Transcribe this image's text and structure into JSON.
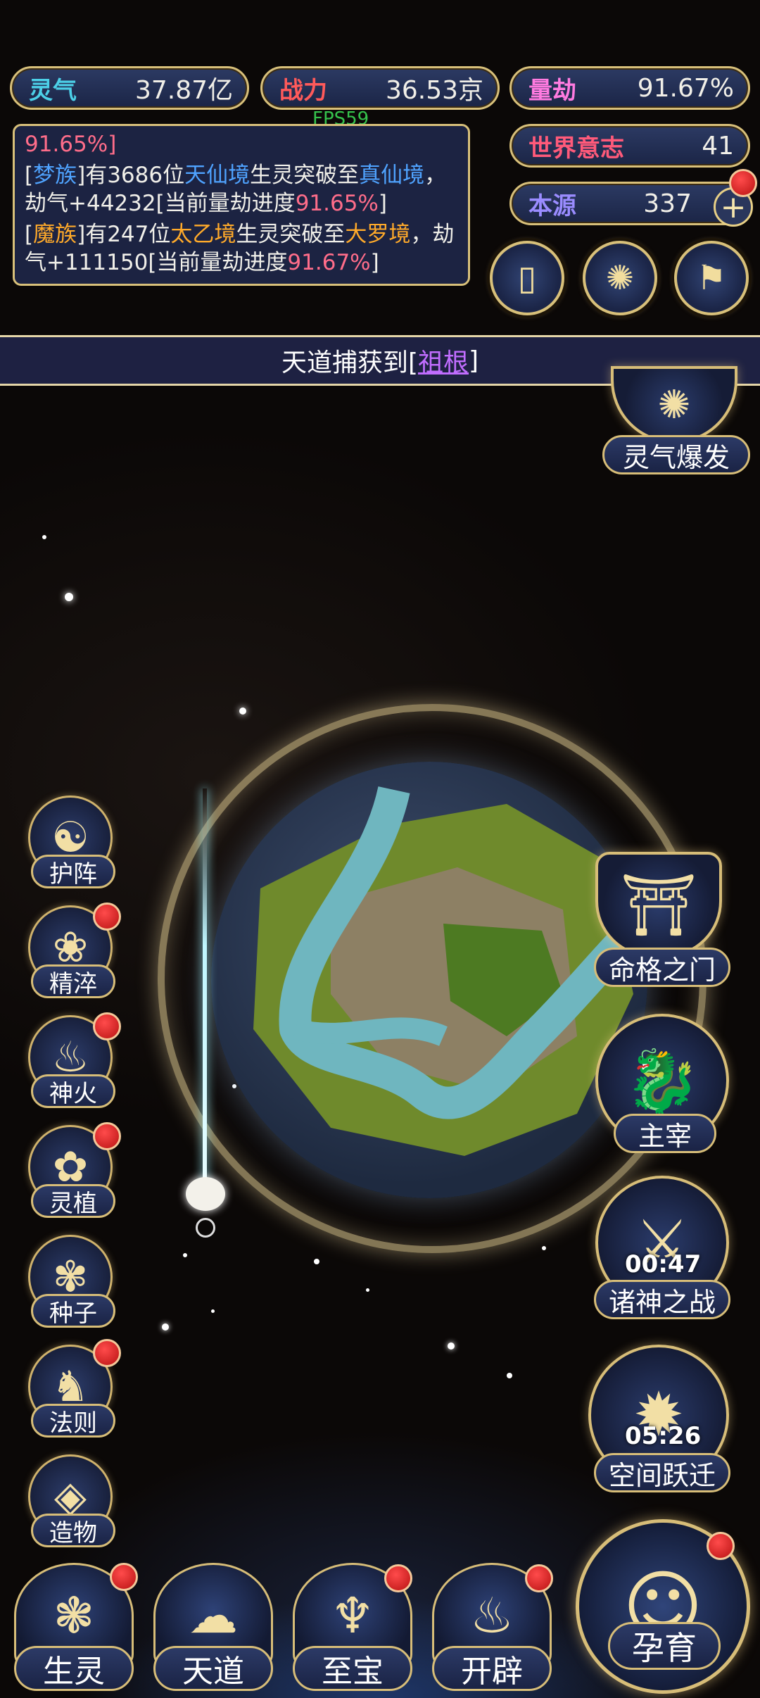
{
  "stats": {
    "lingqi": {
      "label": "灵气",
      "value": "37.87亿",
      "color": "#4cd0e8"
    },
    "zhanli": {
      "label": "战力",
      "value": "36.53京",
      "color": "#ff5a5a"
    },
    "liangjie": {
      "label": "量劫",
      "value": "91.67%",
      "color": "#ff7be0"
    },
    "shijie": {
      "label": "世界意志",
      "value": "41",
      "color": "#ff5a7a"
    },
    "benyuan": {
      "label": "本源",
      "value": "337",
      "color": "#9a8cff"
    }
  },
  "fps": "FPS59",
  "log": {
    "line0": "91.65%]",
    "entry1": {
      "b1": "[",
      "race": "梦族",
      "t1": "]有3686位",
      "realm": "天仙境",
      "t2": "生灵突破至",
      "target": "真仙境",
      "t3": "，劫气+44232[当前量劫进度",
      "pct": "91.65%",
      "t4": "]"
    },
    "entry2": {
      "b1": "[",
      "race": "魔族",
      "t1": "]有247位",
      "realm": "太乙境",
      "t2": "生灵突破至",
      "target": "大罗境",
      "t3": "，劫气+111150[当前量劫进度",
      "pct": "91.67%",
      "t4": "]"
    }
  },
  "top_buttons": [
    {
      "icon": "card-icon",
      "glyph": "▯"
    },
    {
      "icon": "vortex-icon",
      "glyph": "✺"
    },
    {
      "icon": "flag-icon",
      "glyph": "⚑"
    }
  ],
  "plus": "+",
  "banner": {
    "prefix": "天道捕获到[",
    "link": "祖根",
    "suffix": "]"
  },
  "burst_label": "灵气爆发",
  "left_menu": [
    "护阵",
    "精淬",
    "神火",
    "灵植",
    "种子",
    "法则",
    "造物"
  ],
  "left_glyphs": [
    "☯",
    "❀",
    "♨",
    "✿",
    "✾",
    "♞",
    "◈"
  ],
  "right_menu": {
    "fate_gate": "命格之门",
    "master": "主宰",
    "gods_war": "诸神之战",
    "gods_war_timer": "00:47",
    "space_jump": "空间跃迁",
    "space_jump_timer": "05:26"
  },
  "bottom_nav": [
    "生灵",
    "天道",
    "至宝",
    "开辟"
  ],
  "bottom_glyphs": [
    "❃",
    "☁",
    "♆",
    "♨"
  ],
  "nurture": "孕育",
  "accent": "#d8c07a"
}
